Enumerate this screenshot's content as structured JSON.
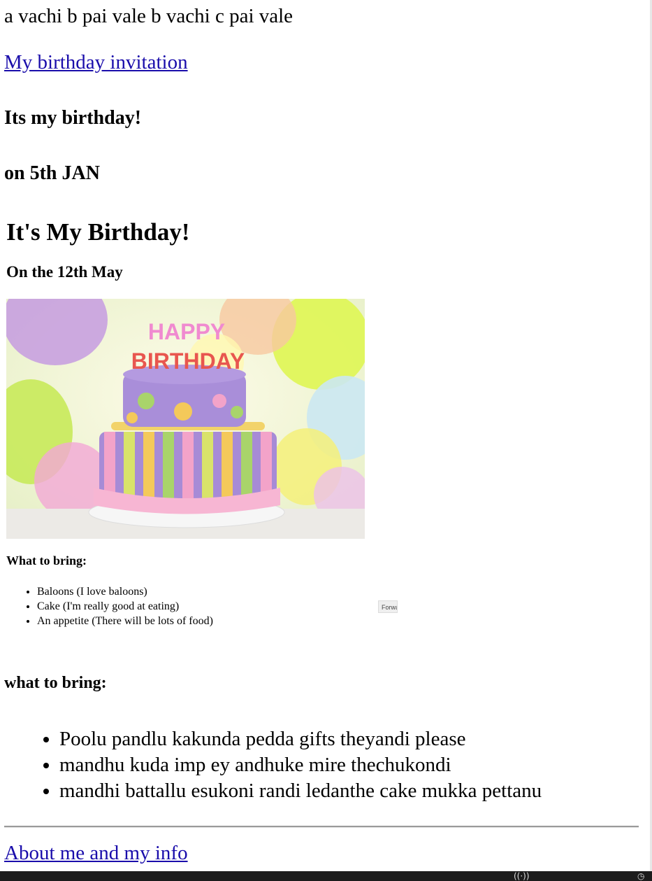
{
  "intro_text": "a vachi b pai vale b vachi c pai vale",
  "links": {
    "invitation": "My birthday invitation",
    "about": "About me and my info"
  },
  "headings": {
    "its_my_birthday": "Its my birthday!",
    "on_date": "on 5th JAN",
    "what_to_bring": "what to bring:"
  },
  "embedded": {
    "title": "It's My Birthday!",
    "subtitle": "On the 12th May",
    "photo_text": {
      "line1": "HAPPY",
      "line2": "BIRTHDAY"
    },
    "bring_heading": "What to bring:",
    "items": [
      "Baloons (I love baloons)",
      "Cake (I'm really good at eating)",
      "An appetite (There will be lots of food)"
    ],
    "forward_button": "Forwa"
  },
  "bring_list": [
    "Poolu pandlu kakunda pedda gifts theyandi please",
    "mandhu kuda imp ey andhuke mire thechukondi",
    "mandhi battallu esukoni randi ledanthe cake mukka pettanu"
  ],
  "colors": {
    "link": "#1a0dab",
    "taskbar": "#1c1c1c"
  }
}
